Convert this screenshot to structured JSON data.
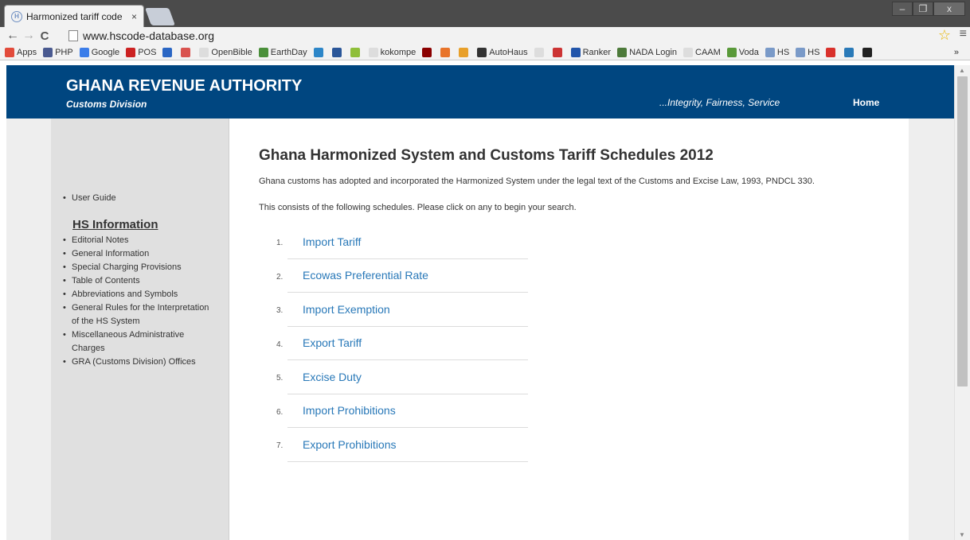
{
  "browser": {
    "tab_title": "Harmonized tariff code",
    "tab_close": "×",
    "favicon_letter": "H",
    "url": "www.hscode-database.org",
    "window_controls": [
      "–",
      "❐",
      "x"
    ]
  },
  "bookmarks": [
    {
      "label": "Apps",
      "icon": "apps-grid-icon",
      "color": "#e24b3b"
    },
    {
      "label": "PHP",
      "icon": "php-icon",
      "color": "#4a5a90"
    },
    {
      "label": "Google",
      "icon": "google-icon",
      "color": "#3b7de9"
    },
    {
      "label": "POS",
      "icon": "pos-icon",
      "color": "#cc2222"
    },
    {
      "label": "",
      "icon": "checkmark-icon",
      "color": "#2a66c4"
    },
    {
      "label": "",
      "icon": "br-icon",
      "color": "#d9534f"
    },
    {
      "label": "OpenBible",
      "icon": "page-icon",
      "color": "#dddddd"
    },
    {
      "label": "EarthDay",
      "icon": "earthday-icon",
      "color": "#4a8f3a"
    },
    {
      "label": "",
      "icon": "circle-blue-icon",
      "color": "#2d86c8"
    },
    {
      "label": "",
      "icon": "w-icon",
      "color": "#2a5699"
    },
    {
      "label": "",
      "icon": "android-icon",
      "color": "#8fbf3a"
    },
    {
      "label": "kokompe",
      "icon": "page-icon",
      "color": "#dddddd"
    },
    {
      "label": "",
      "icon": "dark-red-icon",
      "color": "#8b0000"
    },
    {
      "label": "",
      "icon": "ring-icon",
      "color": "#e8742a"
    },
    {
      "label": "",
      "icon": "shield-icon",
      "color": "#e8a02a"
    },
    {
      "label": "AutoHaus",
      "icon": "autohaus-icon",
      "color": "#333333"
    },
    {
      "label": "",
      "icon": "page-icon",
      "color": "#dddddd"
    },
    {
      "label": "",
      "icon": "no-sign-icon",
      "color": "#cc3333"
    },
    {
      "label": "Ranker",
      "icon": "r-icon",
      "color": "#2255aa"
    },
    {
      "label": "NADA Login",
      "icon": "nada-icon",
      "color": "#4d7a3a"
    },
    {
      "label": "CAAM",
      "icon": "page-icon",
      "color": "#dddddd"
    },
    {
      "label": "Voda",
      "icon": "voda-icon",
      "color": "#5a9a3a"
    },
    {
      "label": "HS",
      "icon": "hs-icon",
      "color": "#7a9ac8"
    },
    {
      "label": "HS",
      "icon": "hs-icon",
      "color": "#7a9ac8"
    },
    {
      "label": "",
      "icon": "red-square-icon",
      "color": "#d9312b"
    },
    {
      "label": "",
      "icon": "c-icon",
      "color": "#2a7ab8"
    },
    {
      "label": "",
      "icon": "m-icon",
      "color": "#222222"
    }
  ],
  "bookmarks_overflow": "»",
  "header": {
    "title": "GHANA REVENUE AUTHORITY",
    "subtitle": "Customs Division",
    "motto": "...Integrity, Fairness, Service",
    "home": "Home",
    "bg_color": "#004680"
  },
  "sidebar": {
    "top_items": [
      "User Guide"
    ],
    "heading": "HS Information",
    "items": [
      "Editorial Notes",
      "General Information",
      "Special Charging Provisions",
      "Table of Contents",
      "Abbreviations and Symbols",
      "General Rules for the Interpretation of the HS System",
      "Miscellaneous Administrative Charges",
      "GRA (Customs Division) Offices"
    ]
  },
  "main": {
    "title": "Ghana Harmonized System and Customs Tariff Schedules 2012",
    "intro1": "Ghana customs has adopted and incorporated the Harmonized System under the legal text of the Customs and Excise Law, 1993, PNDCL 330.",
    "intro2": "This consists of the following schedules. Please click on any to begin your search.",
    "link_color": "#2878b8",
    "schedules": [
      {
        "num": "1.",
        "label": "Import Tariff"
      },
      {
        "num": "2.",
        "label": "Ecowas Preferential Rate"
      },
      {
        "num": "3.",
        "label": "Import Exemption"
      },
      {
        "num": "4.",
        "label": "Export Tariff"
      },
      {
        "num": "5.",
        "label": "Excise Duty"
      },
      {
        "num": "6.",
        "label": "Import Prohibitions"
      },
      {
        "num": "7.",
        "label": "Export Prohibitions"
      }
    ]
  }
}
